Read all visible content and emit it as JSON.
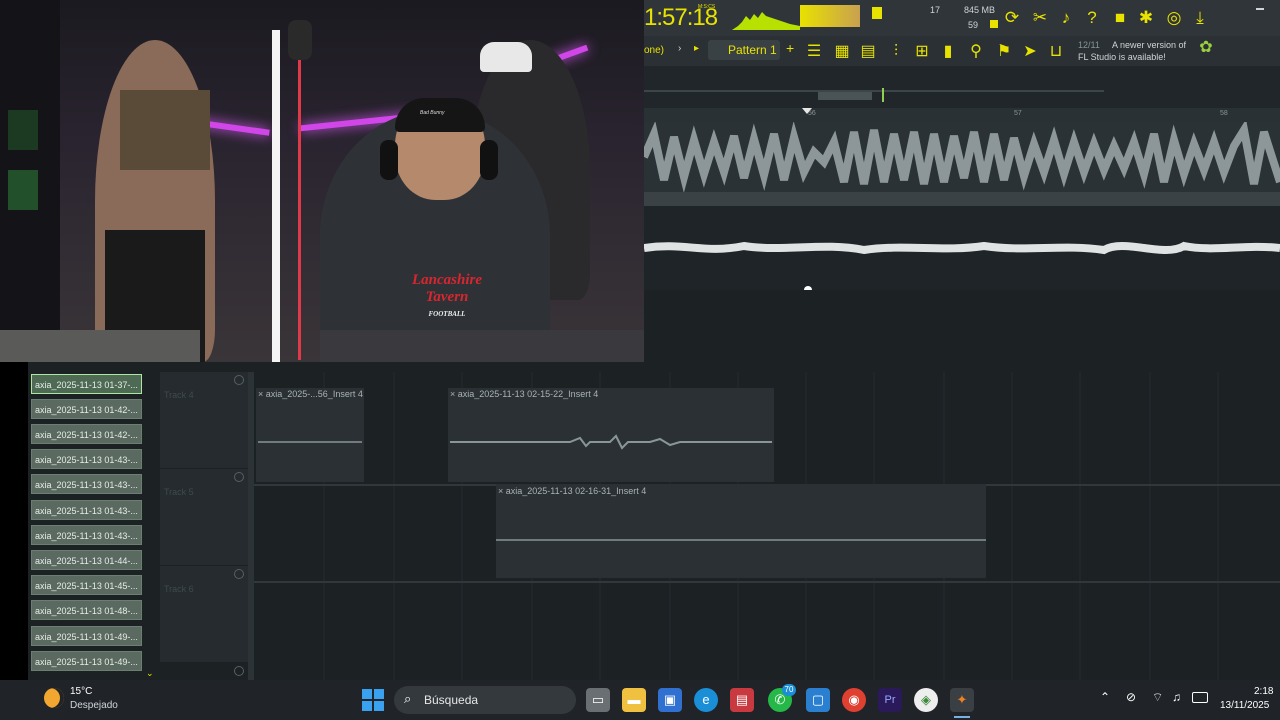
{
  "fl_studio": {
    "time_display": "1:57:18",
    "time_unit_label": "M:S:CS",
    "cpu_value": "17",
    "memory": "845 MB",
    "polyphony": "59",
    "pattern_label": "Pattern 1",
    "left_cut_label": "one)",
    "plus_label": "+",
    "news_count": "12/11",
    "news_text_line1": "A newer version of",
    "news_text_line2": "FL Studio is available!",
    "ruler_marks": [
      "56",
      "57",
      "58"
    ],
    "accent_color": "#e8e200"
  },
  "browser": {
    "items": [
      "axia_2025-11-13 01-37-...",
      "axia_2025-11-13 01-42-...",
      "axia_2025-11-13 01-42-...",
      "axia_2025-11-13 01-43-...",
      "axia_2025-11-13 01-43-...",
      "axia_2025-11-13 01-43-...",
      "axia_2025-11-13 01-43-...",
      "axia_2025-11-13 01-44-...",
      "axia_2025-11-13 01-45-...",
      "axia_2025-11-13 01-48-...",
      "axia_2025-11-13 01-49-...",
      "axia_2025-11-13 01-49-..."
    ]
  },
  "playlist": {
    "tracks": [
      {
        "name": "Track 4"
      },
      {
        "name": "Track 5"
      },
      {
        "name": "Track 6"
      }
    ],
    "clips": [
      {
        "title": "axia_2025-...56_Insert 4"
      },
      {
        "title": "axia_2025-11-13 02-15-22_Insert 4"
      },
      {
        "title": "axia_2025-11-13 02-16-31_Insert 4"
      }
    ]
  },
  "webcam": {
    "shirt_text_line1": "Lancashire",
    "shirt_text_line2": "Tavern",
    "shirt_text_line3": "FOOTBALL",
    "cap_text": "Bad Bunny"
  },
  "taskbar": {
    "weather_temp": "15°C",
    "weather_desc": "Despejado",
    "search_placeholder": "Búsqueda",
    "whatsapp_badge": "70",
    "time": "2:18",
    "date": "13/11/2025"
  }
}
